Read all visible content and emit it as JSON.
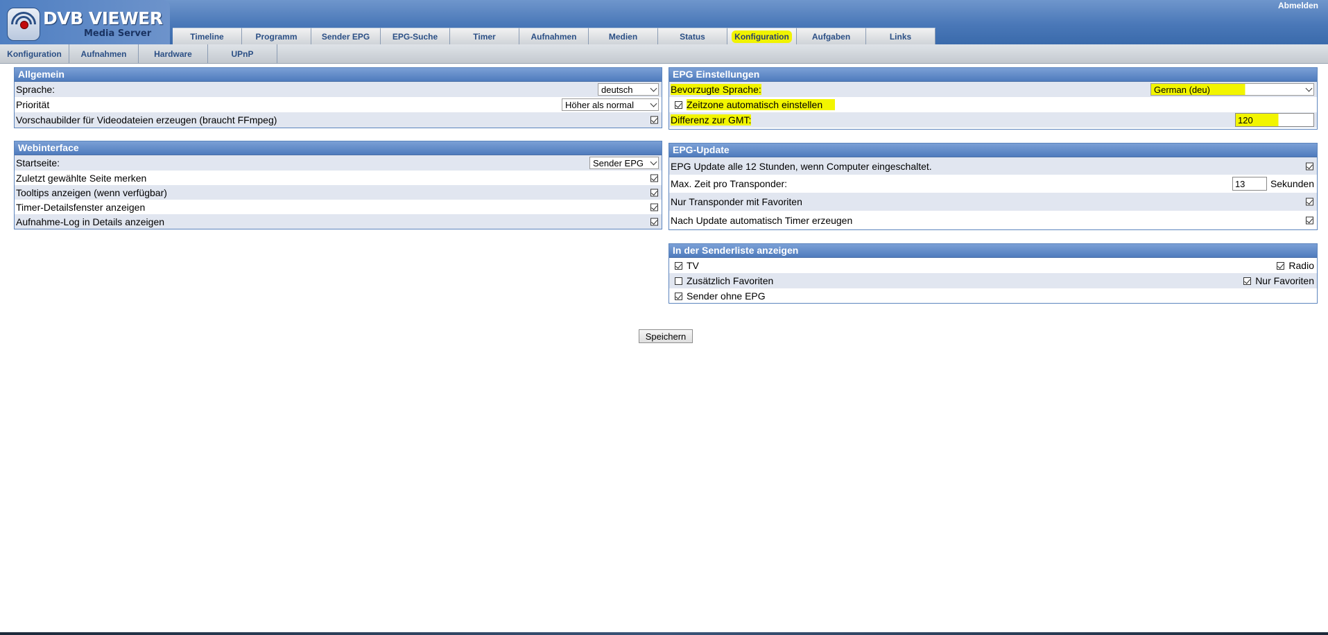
{
  "app": {
    "logo_title": "DVB VIEWER",
    "logo_subtitle": "Media Server",
    "logout": "Abmelden"
  },
  "nav": {
    "tabs": [
      "Timeline",
      "Programm",
      "Sender EPG",
      "EPG-Suche",
      "Timer",
      "Aufnahmen",
      "Medien",
      "Status",
      "Konfiguration",
      "Aufgaben",
      "Links"
    ],
    "active_tab": "Konfiguration"
  },
  "subnav": {
    "items": [
      "Konfiguration",
      "Aufnahmen",
      "Hardware",
      "UPnP"
    ]
  },
  "allgemein": {
    "title": "Allgemein",
    "language_label": "Sprache:",
    "language_value": "deutsch",
    "priority_label": "Priorität",
    "priority_value": "Höher als normal",
    "thumbnails_label": "Vorschaubilder für Videodateien erzeugen (braucht FFmpeg)",
    "thumbnails_checked": true
  },
  "webinterface": {
    "title": "Webinterface",
    "startpage_label": "Startseite:",
    "startpage_value": "Sender EPG",
    "rows": [
      {
        "label": "Zuletzt gewählte Seite merken",
        "checked": true
      },
      {
        "label": "Tooltips anzeigen (wenn verfügbar)",
        "checked": true
      },
      {
        "label": "Timer-Detailsfenster anzeigen",
        "checked": true
      },
      {
        "label": "Aufnahme-Log in Details anzeigen",
        "checked": true
      }
    ]
  },
  "epg_settings": {
    "title": "EPG Einstellungen",
    "language_label": "Bevorzugte Sprache:",
    "language_value": "German (deu)",
    "timezone_label": "Zeitzone automatisch einstellen",
    "timezone_checked": true,
    "gmt_label": "Differenz zur GMT:",
    "gmt_value": "120"
  },
  "epg_update": {
    "title": "EPG-Update",
    "every_label": "EPG Update alle 12 Stunden, wenn Computer eingeschaltet.",
    "every_checked": true,
    "max_time_label": "Max. Zeit pro Transponder:",
    "max_time_value": "13",
    "max_time_unit": "Sekunden",
    "fav_only_label": "Nur Transponder mit Favoriten",
    "fav_only_checked": true,
    "auto_timer_label": "Nach Update automatisch Timer erzeugen",
    "auto_timer_checked": true
  },
  "channel_list": {
    "title": "In der Senderliste anzeigen",
    "tv_label": "TV",
    "tv_checked": true,
    "radio_label": "Radio",
    "radio_checked": true,
    "extra_fav_label": "Zusätzlich Favoriten",
    "extra_fav_checked": false,
    "only_fav_label": "Nur Favoriten",
    "only_fav_checked": true,
    "no_epg_label": "Sender ohne EPG",
    "no_epg_checked": true
  },
  "save_button": "Speichern",
  "colors": {
    "highlight": "#f2f500",
    "header_blue": "#4a78b8",
    "panel_head": "#5b84bd"
  }
}
